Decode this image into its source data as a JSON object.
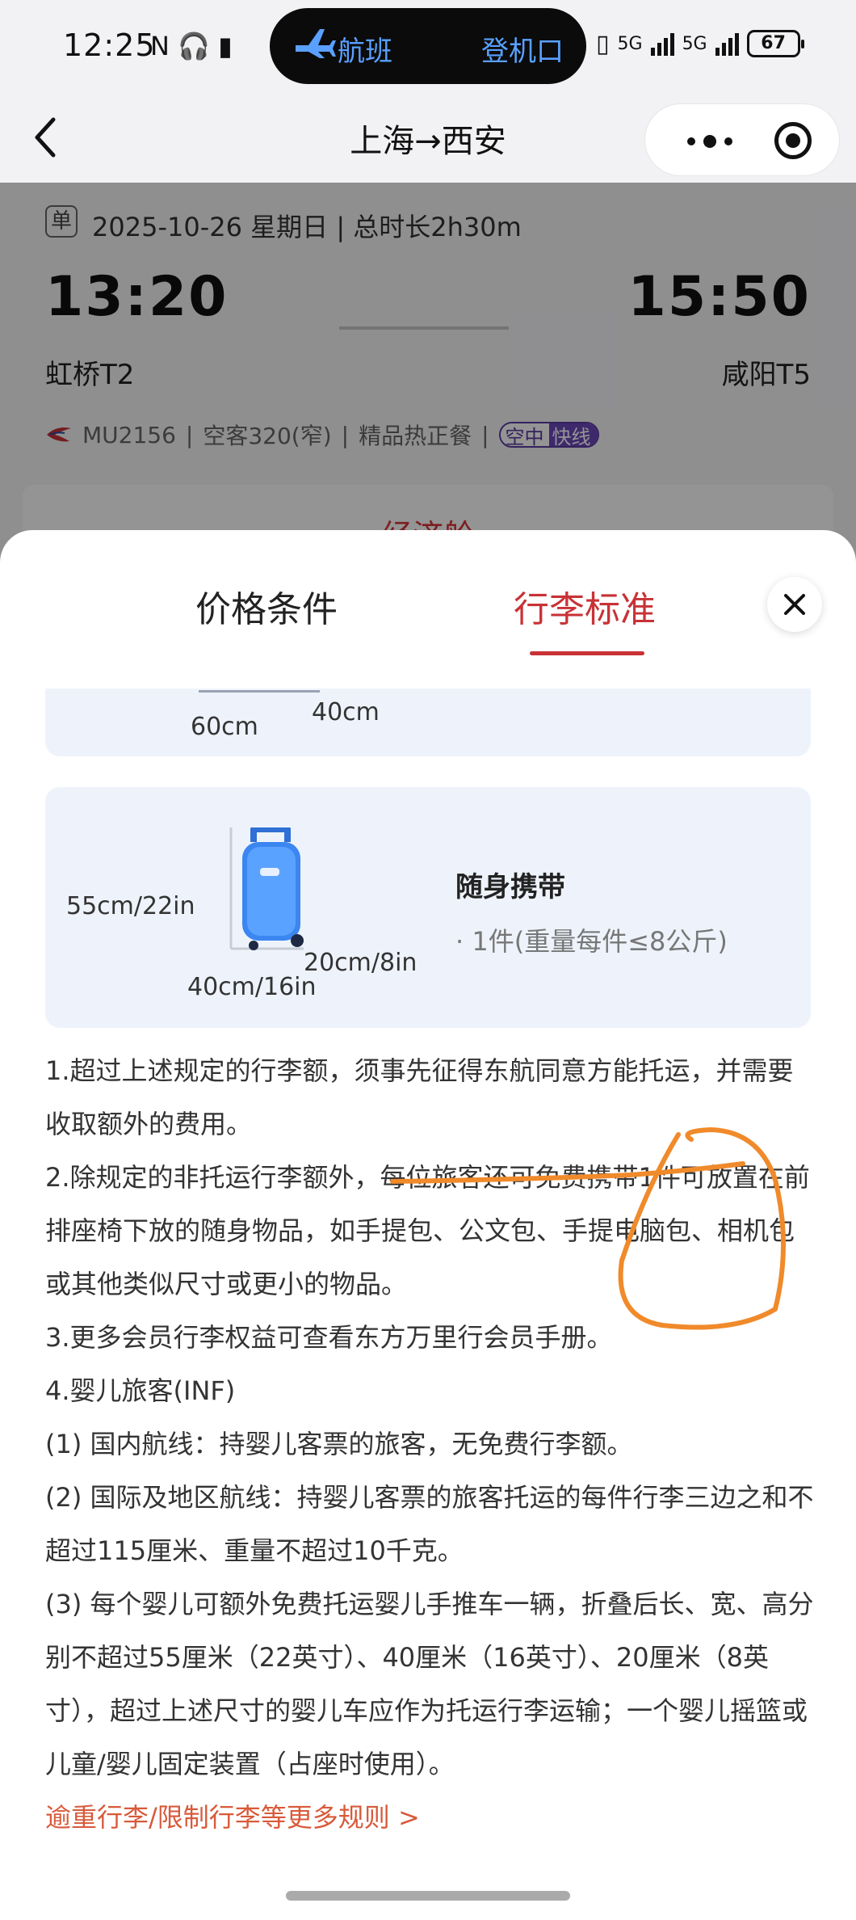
{
  "status_bar": {
    "time": "12:25",
    "left_icons": "N 🎧 ▮",
    "pill_left": "航班",
    "pill_right": "登机口",
    "network_1": "5G",
    "network_2": "5G",
    "battery": "67"
  },
  "nav": {
    "title": "上海→西安"
  },
  "flight": {
    "trip_type": "单",
    "date_line": "2025-10-26 星期日 | 总时长2h30m",
    "departure_time": "13:20",
    "arrival_time": "15:50",
    "departure_airport": "虹桥T2",
    "arrival_airport": "咸阳T5",
    "flight_no": "MU2156",
    "aircraft": "空客320(窄)",
    "meal": "精品热正餐",
    "badge_left": "空中",
    "badge_right": "快线",
    "cabin": "经济舱"
  },
  "sheet": {
    "tab_price": "价格条件",
    "tab_baggage": "行李标准",
    "checked_dims": {
      "width": "60cm",
      "depth": "40cm"
    },
    "carry_on": {
      "height": "55cm/22in",
      "width": "40cm/16in",
      "depth": "20cm/8in",
      "title": "随身携带",
      "detail": "· 1件(重量每件≤8公斤)"
    },
    "rules": [
      "1.超过上述规定的行李额，须事先征得东航同意方能托运，并需要收取额外的费用。",
      "2.除规定的非托运行李额外，每位旅客还可免费携带1件可放置在前排座椅下放的随身物品，如手提包、公文包、手提电脑包、相机包或其他类似尺寸或更小的物品。",
      "3.更多会员行李权益可查看东方万里行会员手册。",
      "4.婴儿旅客(INF)",
      "(1) 国内航线：持婴儿客票的旅客，无免费行李额。",
      "(2) 国际及地区航线：持婴儿客票的旅客托运的每件行李三边之和不超过115厘米、重量不超过10千克。",
      "(3) 每个婴儿可额外免费托运婴儿手推车一辆，折叠后长、宽、高分别不超过55厘米（22英寸）、40厘米（16英寸）、20厘米（8英寸），超过上述尺寸的婴儿车应作为托运行李运输；一个婴儿摇篮或儿童/婴儿固定装置（占座时使用）。"
    ],
    "more_link": "逾重行李/限制行李等更多规则 >"
  },
  "colors": {
    "accent_red": "#c83236",
    "card_bg": "#eef3fb",
    "annotation_orange": "#f08a2a",
    "pill_text": "#5aa0ff"
  }
}
